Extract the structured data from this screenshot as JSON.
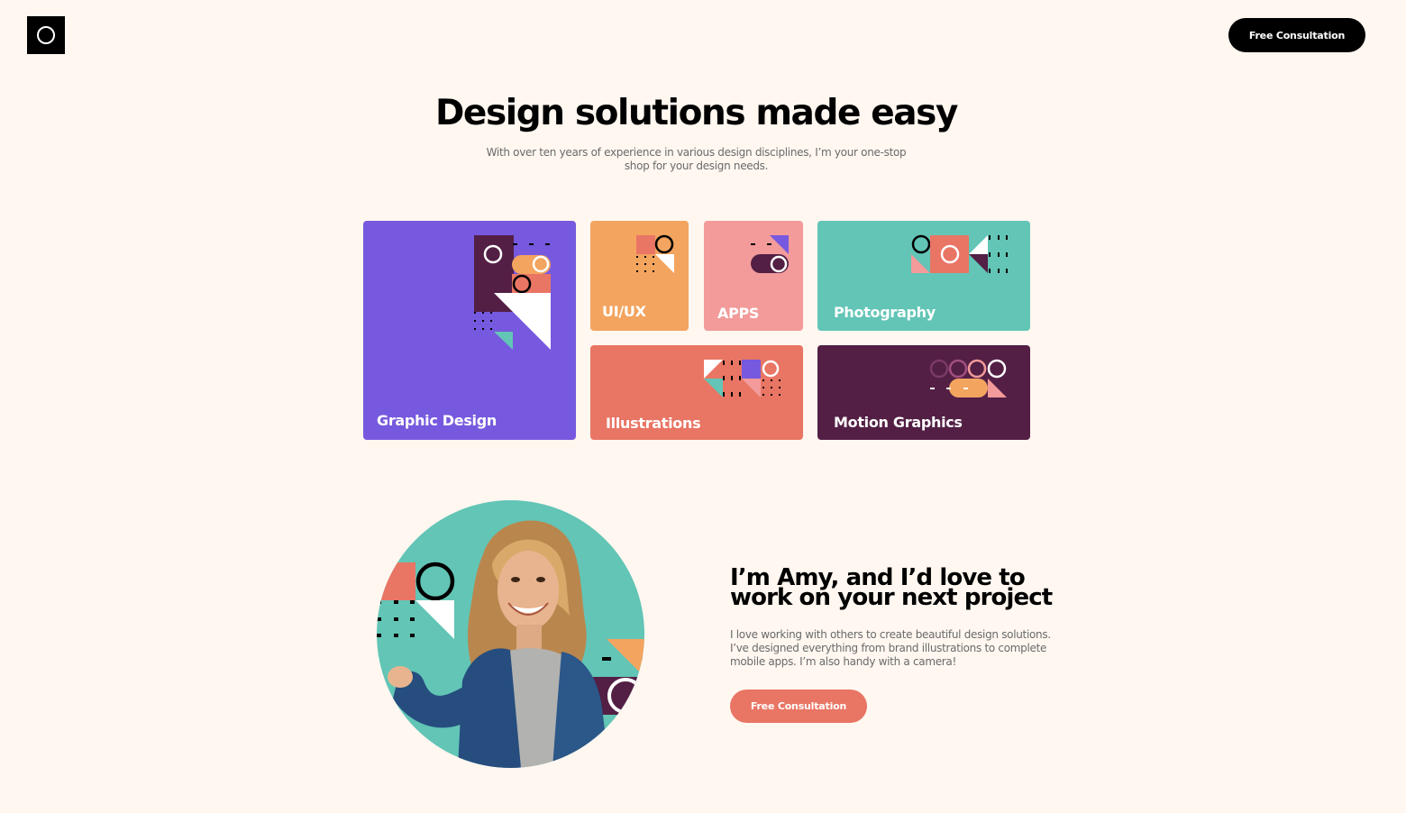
{
  "header": {
    "logo_icon": "ring-logo-icon",
    "cta_label": "Free Consultation"
  },
  "hero": {
    "title": "Design solutions made easy",
    "subtitle": "With over ten years of experience in various design disciplines, I’m your one-stop shop for your design needs."
  },
  "services": [
    {
      "label": "Graphic Design",
      "color": "#7659de"
    },
    {
      "label": "UI/UX",
      "color": "#f3a45f"
    },
    {
      "label": "APPS",
      "color": "#f29b9a"
    },
    {
      "label": "Photography",
      "color": "#62c5b6"
    },
    {
      "label": "Illustrations",
      "color": "#e97564"
    },
    {
      "label": "Motion Graphics",
      "color": "#531f45"
    }
  ],
  "about": {
    "title_line1": "I’m Amy, and I’d love to",
    "title_line2": "work on your next project",
    "text": "I love working with others to create beautiful design solutions. I’ve designed everything from brand illustrations to complete mobile apps. I’m also handy with a camera!",
    "cta_label": "Free Consultation",
    "portrait_icon": "person-portrait-icon"
  },
  "colors": {
    "background": "#fff7f0",
    "purple": "#7659de",
    "orange": "#f3a45f",
    "pink": "#f29b9a",
    "teal": "#62c5b6",
    "coral": "#e97564",
    "plum": "#531f45"
  }
}
